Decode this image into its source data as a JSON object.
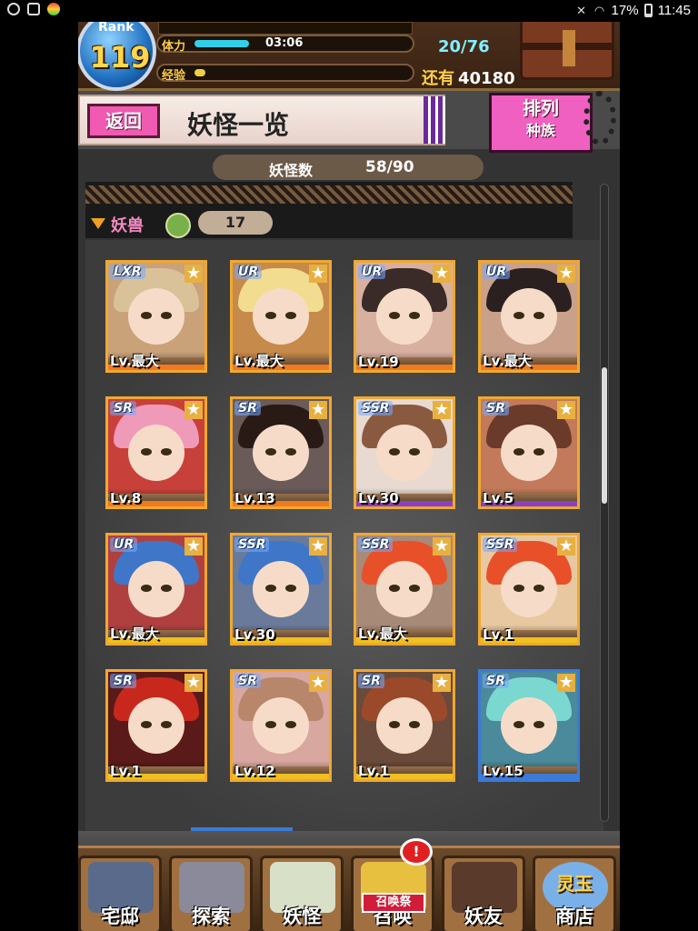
{
  "status_bar": {
    "battery": "17%",
    "time": "11:45",
    "icons": [
      "alarm-icon",
      "image-icon",
      "app-icon",
      "mute-icon",
      "wifi-icon",
      "battery-icon"
    ]
  },
  "header": {
    "rank_label": "Rank",
    "rank_value": "119",
    "stamina_label": "体力",
    "stamina_timer": "03:06",
    "stamina_count": "20/76",
    "stamina_fraction": 0.26,
    "exp_label": "经验",
    "exp_fraction": 0.05,
    "remaining_label": "还有",
    "remaining_value": "40180",
    "chest_icon": "treasure-chest-icon"
  },
  "title_bar": {
    "back_label": "返回",
    "title": "妖怪一览",
    "sort_label_1": "排列",
    "sort_label_2": "种族"
  },
  "count_bar": {
    "label": "妖怪数",
    "value": "58/90"
  },
  "category": {
    "name": "妖兽",
    "count": "17"
  },
  "cards": [
    {
      "rarity": "LXR",
      "level": "Lv.最大",
      "hair": "#d9c29a",
      "bg": "#c9a27a",
      "stripe": "#f07a20"
    },
    {
      "rarity": "UR",
      "level": "Lv.最大",
      "hair": "#f2dc90",
      "bg": "#c68a4a",
      "stripe": "#f07a20"
    },
    {
      "rarity": "UR",
      "level": "Lv.19",
      "hair": "#3a2a28",
      "bg": "#d8b0a0",
      "stripe": "#f07a20"
    },
    {
      "rarity": "UR",
      "level": "Lv.最大",
      "hair": "#2a2020",
      "bg": "#c9a08a",
      "stripe": "#f07a20"
    },
    {
      "rarity": "SR",
      "level": "Lv.8",
      "hair": "#ef9ab8",
      "bg": "#c8403a",
      "stripe": "#f07a20"
    },
    {
      "rarity": "SR",
      "level": "Lv.13",
      "hair": "#2a1a16",
      "bg": "#6a5a58",
      "stripe": "#f07a20"
    },
    {
      "rarity": "SSR",
      "level": "Lv.30",
      "hair": "#8a5a40",
      "bg": "#e8dad0",
      "stripe": "#8a40c0"
    },
    {
      "rarity": "SR",
      "level": "Lv.5",
      "hair": "#6a3a2a",
      "bg": "#c27a5a",
      "stripe": "#8a40c0"
    },
    {
      "rarity": "UR",
      "level": "Lv.最大",
      "hair": "#3f76c8",
      "bg": "#b04040",
      "stripe": "#f0c020"
    },
    {
      "rarity": "SSR",
      "level": "Lv.30",
      "hair": "#3f76c8",
      "bg": "#6a7a9a",
      "stripe": "#f0c020"
    },
    {
      "rarity": "SSR",
      "level": "Lv.最大",
      "hair": "#e8502a",
      "bg": "#a88a78",
      "stripe": "#f0c020"
    },
    {
      "rarity": "SSR",
      "level": "Lv.1",
      "hair": "#e8502a",
      "bg": "#e8c8a0",
      "stripe": "#f0c020"
    },
    {
      "rarity": "SR",
      "level": "Lv.1",
      "hair": "#c8281c",
      "bg": "#5a1a1a",
      "stripe": "#f0c020"
    },
    {
      "rarity": "SR",
      "level": "Lv.12",
      "hair": "#b8866a",
      "bg": "#d8a8a0",
      "stripe": "#f0c020"
    },
    {
      "rarity": "SR",
      "level": "Lv.1",
      "hair": "#9a4a2a",
      "bg": "#6a4a3a",
      "stripe": "#f0c020"
    },
    {
      "rarity": "SR",
      "level": "Lv.15",
      "hair": "#7ad8d0",
      "bg": "#4a8a9a",
      "stripe": "#3b7ad8"
    }
  ],
  "scroll_fraction": 0.37,
  "nav": [
    {
      "label": "宅邸",
      "icon": "house-icon",
      "art": "#5a6a8a"
    },
    {
      "label": "探索",
      "icon": "magnifier-icon",
      "art": "#8a8a9a"
    },
    {
      "label": "妖怪",
      "icon": "scroll-icon",
      "art": "#d8e0c8"
    },
    {
      "label": "召唤",
      "icon": "summon-star-icon",
      "art": "#e8c040"
    },
    {
      "label": "妖友",
      "icon": "fox-girl-icon",
      "art": "#5a3a2a"
    },
    {
      "label": "商店",
      "icon": "orb-icon",
      "art": "#7ab0e8"
    }
  ],
  "summon_badge": "!",
  "summon_festival": "召唤祭",
  "shop_orb_label": "灵玉"
}
